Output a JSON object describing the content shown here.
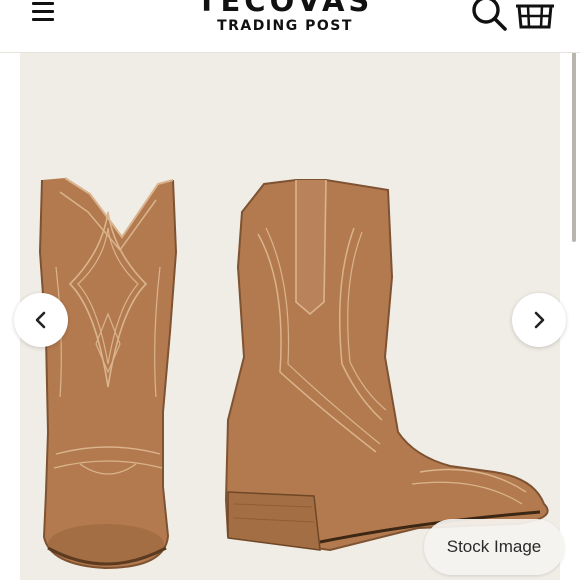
{
  "header": {
    "brand_name": "TECOVAS",
    "brand_subtitle": "TRADING POST",
    "menu_icon": "hamburger-menu-icon",
    "search_icon": "search-icon",
    "cart_icon": "cart-icon"
  },
  "gallery": {
    "background": "#f0ece6",
    "product_colors": {
      "leather": "#b47a4f",
      "stitch": "#d9b48d",
      "heel": "#a46e44"
    },
    "prev_icon": "chevron-left-icon",
    "next_icon": "chevron-right-icon",
    "badge_label": "Stock Image"
  }
}
